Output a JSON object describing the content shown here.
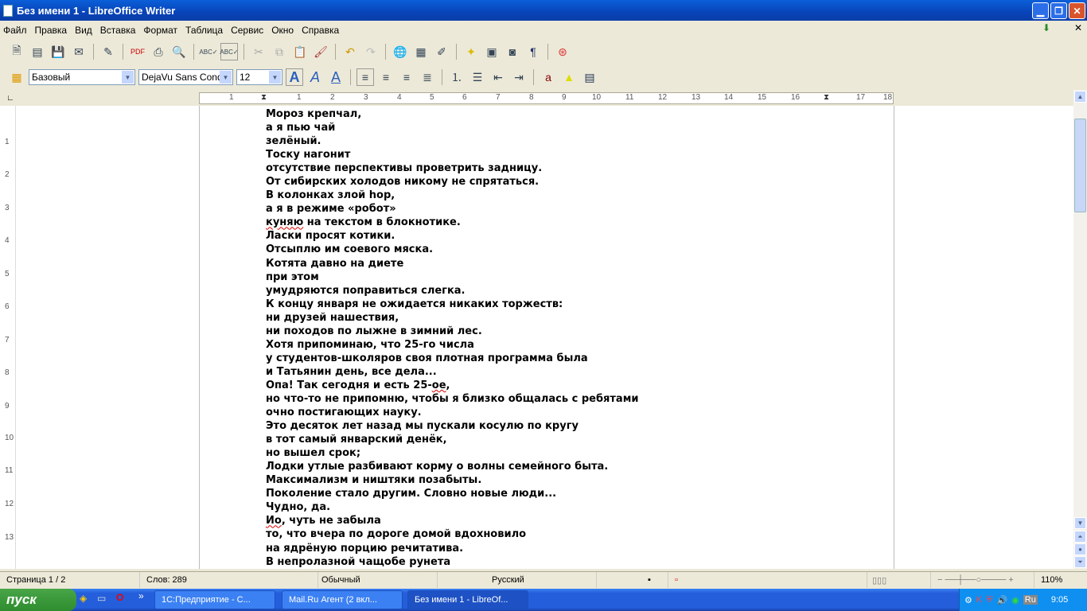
{
  "window": {
    "title": "Без имени 1 - LibreOffice Writer"
  },
  "menu": [
    "Файл",
    "Правка",
    "Вид",
    "Вставка",
    "Формат",
    "Таблица",
    "Сервис",
    "Окно",
    "Справка"
  ],
  "formatting": {
    "style": "Базовый",
    "font": "DejaVu Sans Conder",
    "size": "12"
  },
  "ruler": {
    "h": [
      "1",
      "1",
      "2",
      "3",
      "4",
      "5",
      "6",
      "7",
      "8",
      "9",
      "10",
      "11",
      "12",
      "13",
      "14",
      "15",
      "16",
      "17",
      "18"
    ],
    "v": [
      "1",
      "2",
      "3",
      "4",
      "5",
      "6",
      "7",
      "8",
      "9",
      "10",
      "11",
      "12",
      "13"
    ]
  },
  "document": {
    "lines": [
      "Мороз крепчал,",
      "а я пью чай",
      "зелёный.",
      "Тоску нагонит",
      "отсутствие перспективы проветрить задницу.",
      "От сибирских холодов никому не спрятаться.",
      "В колонках злой hop,",
      "а я в режиме «робот»",
      "куняю на текстом в блокнотике.",
      "Ласки просят котики.",
      "Отсыплю им соевого мяска.",
      "Котята давно на диете",
      "при этом",
      "умудряются поправиться слегка.",
      "К концу января не ожидается никаких торжеств:",
      "ни друзей нашествия,",
      "ни походов по лыжне в зимний лес.",
      "Хотя припоминаю, что 25-го числа",
      "у студентов-школяров своя плотная программа была",
      "и Татьянин день, все дела...",
      "Опа! Так сегодня и есть 25-ое,",
      "но что-то не припомню, чтобы я близко общалась с ребятами",
      "очно постигающих науку.",
      "Это десяток лет назад мы пускали косулю по кругу",
      "в тот самый январский денёк,",
      "но вышел срок;",
      "Лодки утлые разбивают корму о волны семейного быта.",
      "Максимализм и ништяки позабыты.",
      "Поколение стало другим. Словно новые люди...",
      "Чудно, да.",
      "Ио, чуть не забыла",
      "то, что вчера по дороге домой вдохновило",
      "на ядрёную порцию речитатива.",
      "В непролазной чащобе рунета"
    ]
  },
  "status": {
    "page": "Страница 1 / 2",
    "words": "Слов: 289",
    "style": "Обычный",
    "language": "Русский",
    "zoom": "110%",
    "zoom_level": 110
  },
  "taskbar": {
    "start": "пуск",
    "tasks": [
      "1С:Предприятие - С...",
      "Mail.Ru Агент (2 вкл...",
      "Без имени 1 - LibreOf..."
    ],
    "lang": "Ru",
    "clock": "9:05"
  }
}
